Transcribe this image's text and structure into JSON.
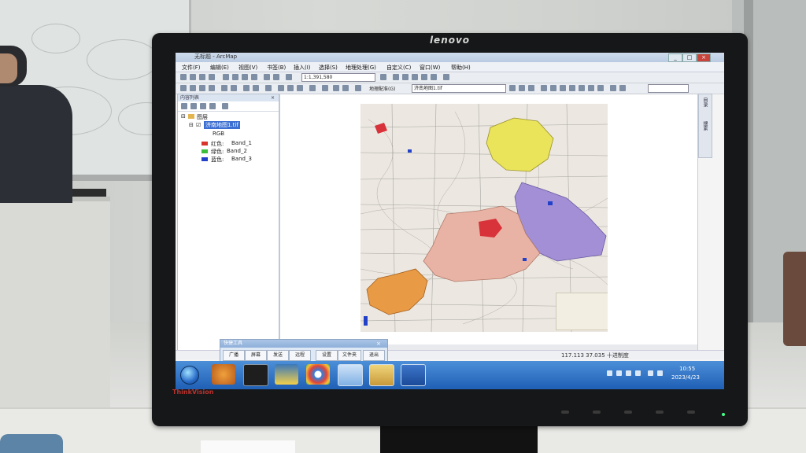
{
  "monitor": {
    "brand": "lenovo",
    "model_badge": "ThinkVision"
  },
  "app": {
    "title": "无标题 - ArcMap",
    "menus": [
      "文件(F)",
      "编辑(E)",
      "视图(V)",
      "书签(B)",
      "插入(I)",
      "选择(S)",
      "地理处理(G)",
      "自定义(C)",
      "窗口(W)",
      "帮助(H)"
    ],
    "scale": "1:1,391,580",
    "georef_label": "地理配准(G)",
    "georef_layer": "济南地图1.tif",
    "window_buttons": [
      "_",
      "□",
      "×"
    ]
  },
  "toc": {
    "title": "内容列表",
    "group": "图层",
    "layer": "济南地图1.tif",
    "rgb_label": "RGB",
    "bands": [
      {
        "channel": "红色:",
        "band": "Band_1",
        "color": "#d8342c"
      },
      {
        "channel": "绿色:",
        "band": "Band_2",
        "color": "#3bbf3b"
      },
      {
        "channel": "蓝色:",
        "band": "Band_3",
        "color": "#2341c8"
      }
    ]
  },
  "right_dock": {
    "tabs": [
      "目录",
      "搜索"
    ]
  },
  "status": {
    "coordinates": "117.113  37.035 十进制度"
  },
  "quick_tools": {
    "title": "快捷工具",
    "close": "×",
    "buttons": [
      "广播",
      "屏幕",
      "发送",
      "远程",
      "设置",
      "文件夹",
      "退出"
    ]
  },
  "taskbar": {
    "time": "10:55",
    "date": "2023/4/23",
    "apps": [
      "start",
      "browser",
      "terminal",
      "python",
      "chrome",
      "search",
      "folder",
      "word"
    ]
  },
  "map_colors": {
    "yellow": "#e9e45a",
    "purple": "#a28fd6",
    "pink": "#e8b3a4",
    "orange": "#e99a44",
    "red": "#d8323a",
    "base": "#ece8e1"
  }
}
